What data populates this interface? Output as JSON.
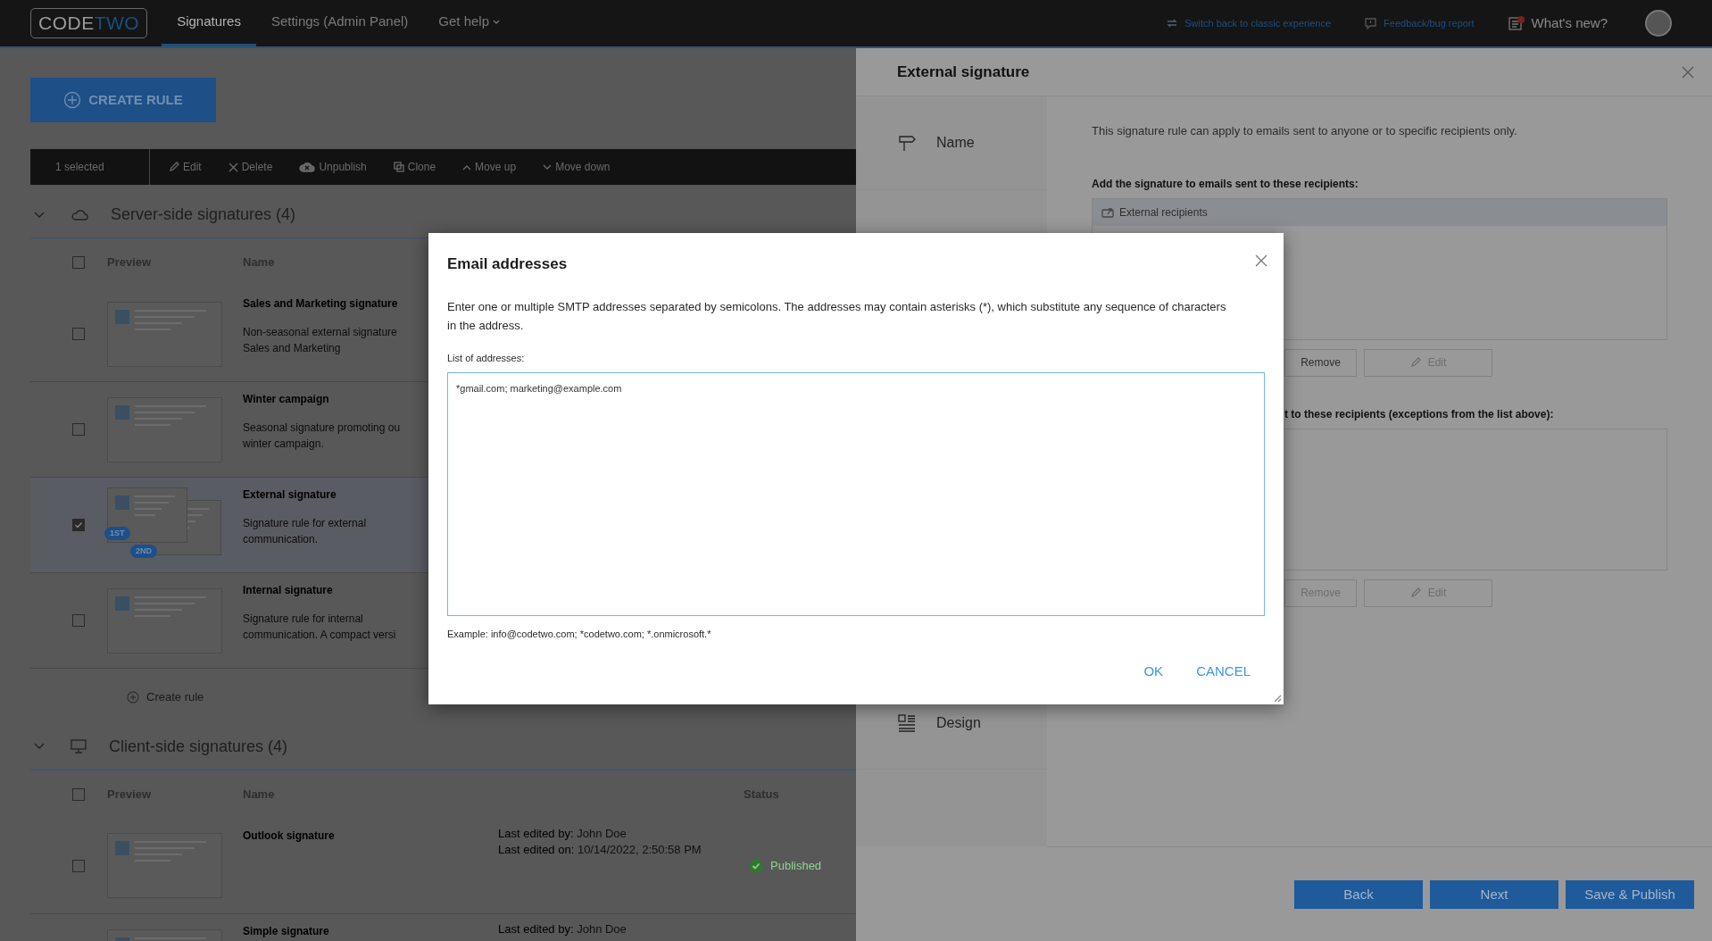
{
  "navbar": {
    "logo": {
      "first": "CODE",
      "second": "TWO"
    },
    "tabs": [
      {
        "label": "Signatures",
        "selected": true,
        "dropdown": false
      },
      {
        "label": "Settings (Admin Panel)",
        "selected": false,
        "dropdown": false
      },
      {
        "label": "Get help",
        "selected": false,
        "dropdown": true
      }
    ],
    "links": [
      {
        "kind": "switch",
        "label": "Switch back to classic experience"
      },
      {
        "kind": "feedback",
        "label": "Feedback/bug report"
      },
      {
        "kind": "news",
        "label": "What's new?"
      }
    ]
  },
  "create_rule_button": "CREATE RULE",
  "toolbar": {
    "selected_count": "1 selected",
    "actions": [
      {
        "kind": "pencil",
        "label": "Edit"
      },
      {
        "kind": "cross",
        "label": "Delete"
      },
      {
        "kind": "cloud",
        "label": "Unpublish"
      },
      {
        "kind": "copy",
        "label": "Clone"
      },
      {
        "kind": "up",
        "label": "Move up"
      },
      {
        "kind": "down",
        "label": "Move down"
      }
    ]
  },
  "sections": [
    {
      "kind": "server",
      "title": "Server-side signatures (4)",
      "expanded": true,
      "all_checked": false,
      "columns": [
        "Preview",
        "Name"
      ],
      "rows": [
        {
          "name": "Sales and Marketing signature",
          "description": [
            "Non-seasonal external signature",
            "Sales and Marketing"
          ],
          "checked": false
        },
        {
          "name": "Winter campaign",
          "description": [
            "Seasonal signature promoting ou",
            "winter campaign."
          ],
          "checked": false
        },
        {
          "name": "External signature",
          "description": [
            "Signature rule for external",
            "communication."
          ],
          "checked": true,
          "badges": [
            "1ST",
            "2ND"
          ]
        },
        {
          "name": "Internal signature",
          "description": [
            "Signature rule for internal",
            "communication. A compact versi"
          ],
          "checked": false
        }
      ],
      "create_rule_link": "Create rule"
    },
    {
      "kind": "client",
      "title": "Client-side signatures (4)",
      "expanded": true,
      "all_checked": false,
      "columns": [
        "Preview",
        "Name",
        "Status"
      ],
      "rows": [
        {
          "name": "Outlook signature",
          "edited_by_label": "Last edited by:",
          "edited_by": "John Doe",
          "edited_on_label": "Last edited on:",
          "edited_on": "10/14/2022, 2:50:58 PM",
          "status": {
            "kind": "published",
            "label": "Published"
          },
          "checked": false
        },
        {
          "name": "Simple signature",
          "edited_by_label": "Last edited by:",
          "edited_by": "John Doe"
        }
      ]
    }
  ],
  "panel": {
    "title": "External signature",
    "steps": [
      {
        "kind": "name",
        "label": "Name"
      },
      {
        "kind": "design",
        "label": "Design"
      }
    ],
    "intro": "This signature rule can apply to emails sent to anyone or to specific recipients only.",
    "include_label": "Add the signature to emails sent to these recipients:",
    "include_items": [
      {
        "label": "External recipients",
        "selected": true
      }
    ],
    "include_buttons": [
      {
        "kind": "remove",
        "label": "Remove",
        "disabled": false
      },
      {
        "kind": "edit",
        "label": "Edit",
        "disabled": true
      }
    ],
    "exclude_label": "t to these recipients (exceptions from the list above):",
    "exclude_buttons": [
      {
        "kind": "remove",
        "label": "Remove",
        "disabled": true
      },
      {
        "kind": "edit",
        "label": "Edit",
        "disabled": true
      }
    ],
    "footer_buttons": [
      "Back",
      "Next",
      "Save & Publish"
    ]
  },
  "dialog": {
    "title": "Email addresses",
    "description": "Enter one or multiple SMTP addresses separated by semicolons. The addresses may contain asterisks (*), which substitute any sequence of characters in the address.",
    "field_label": "List of addresses:",
    "value": "*gmail.com; marketing@example.com",
    "example": "Example: info@codetwo.com; *codetwo.com; *.onmicrosoft.*",
    "buttons": [
      "OK",
      "CANCEL"
    ]
  }
}
